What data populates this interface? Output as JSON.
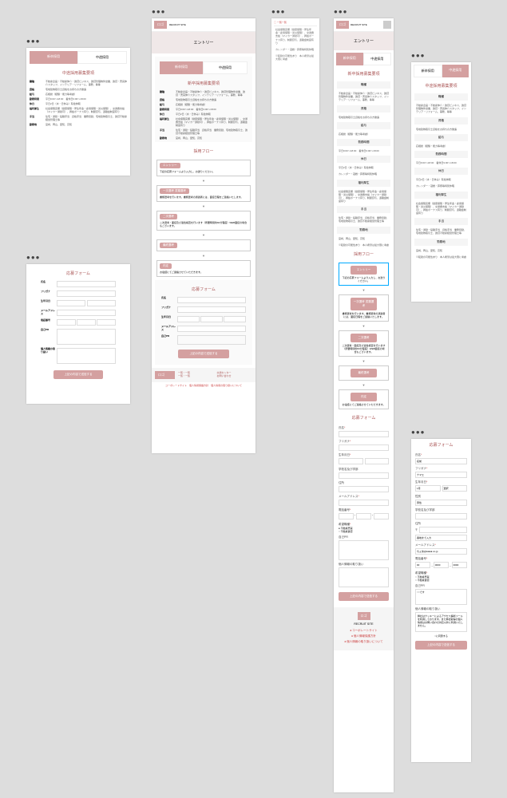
{
  "dots": "●●●",
  "pageTitle": "エントリー",
  "tabs": {
    "new": "新卒採用",
    "mid": "中途採用"
  },
  "reqTitle": "中途採用募集要項",
  "reqTitleNew": "新卒採用募集要項",
  "sections": {
    "job": "職種",
    "jobTxt": "不動産企画・不動産仲介・賃貸ビジネス、賃貸管理物件営業、賃貸・売買仲介スタッフ、インテリア・リフォーム、事務、等等",
    "quals": "資格",
    "qualsTxt": "宅地建物取引士資格をお持ちの方優遇",
    "salary": "給与",
    "salaryTxt": "応相談（経験・能力等考慮）",
    "hours": "勤務時間",
    "hoursTxt": "平日9:00～18:00　着休日9:00～18:00",
    "holiday": "休日",
    "holidayTxt": "平日2日（水・日休み）有給休暇",
    "holidayTxt2": "カレンダー・冠婚・葬祭等特別休暇",
    "benefits": "福利厚生",
    "benefitsTxt": "社会保険完備（健康保険・厚生年金・雇用保険・労災保険）、交通費支給（マイカー通勤可）、昇給ボーナス有り、制服貸与、退職金制度有り",
    "allow": "手当",
    "allowTxt": "住宅・通勤・役職手当　資格手当　業務奨励、宅地建物取引士、賃貸不動産経営管理士等",
    "loc": "勤務地",
    "locTxt": "宮崎、岡山、愛知、高知",
    "locTxt2": "※転勤の可能性あり　本人希望は最大限に考慮"
  },
  "flowTitle": "採用フロー",
  "flow": [
    "エントリー",
    "一次選考 書類選考",
    "二次選考",
    "最終選考",
    "内定"
  ],
  "flowDesc": [
    "下記の応募フォームより入力し、お送りください。",
    "書類選考を行います。書類選考の通過者には、面接日程をご連絡いたします。",
    "二次選考・面接及び適性検査を行います（所要時間約60分程度）WEB面接の場合もございます。",
    "",
    "お電話にてご連絡させていただきます。"
  ],
  "formTitle": "応募フォーム",
  "form": {
    "name": "氏名",
    "nameVal": "名前",
    "kana": "フリガナ",
    "kanaVal": "ナマエ",
    "dob": "生年月日",
    "year": "1月",
    "date": "選択",
    "gender": "性別",
    "male": "男性",
    "female": "女性",
    "school": "学校名及び学部",
    "zip": "〒",
    "addr": "住所",
    "addr2": "番地まで入力",
    "email": "メールアドレス",
    "emailVal": "ちょめ@●●●●.co.jp",
    "tel": "電話番号",
    "tel1": "00",
    "tel2": "0000",
    "tel3": "0000",
    "wish": "希望職種",
    "wish1": "不動産売買",
    "wish2": "不動産賃貸",
    "pr": "自己PR",
    "privacy": "個人情報の取り扱い",
    "privacyTxt": "弊社はクッキーによるアクセス解析ツールを利用しております。また弊社取得の個人情報はお問い合わせ対応以外に利用いたしません。",
    "agree": "○に同意する",
    "submit": "上記の内容で送信する"
  },
  "header": {
    "logo": "ロゴ",
    "site": "RECRUIT SITE"
  },
  "footer": {
    "logo": "ロゴ",
    "site": "RECRUIT SITE",
    "l1": "コーポレートサイト",
    "l2": "個人情報保護方針",
    "l3": "個人情報の取り扱いについて"
  }
}
